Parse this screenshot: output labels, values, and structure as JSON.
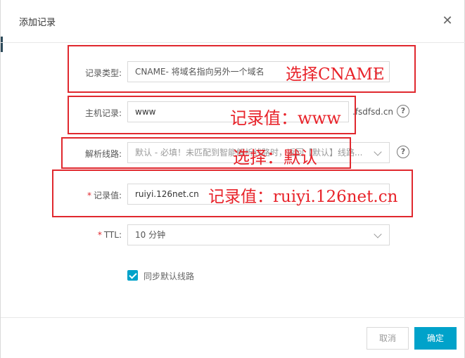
{
  "dialog": {
    "title": "添加记录",
    "close_icon": "close-icon"
  },
  "form": {
    "record_type": {
      "label": "记录类型:",
      "value": "CNAME- 将域名指向另外一个域名"
    },
    "host": {
      "label": "主机记录:",
      "value": "www",
      "suffix": ".fsdfsd.cn"
    },
    "line": {
      "label": "解析线路:",
      "value": "默认 - 必填！未匹配到智能解析线路时，返回【默认】线路..."
    },
    "record_value": {
      "required_mark": "*",
      "label": "记录值:",
      "value": "ruiyi.126net.cn"
    },
    "ttl": {
      "required_mark": "*",
      "label": "TTL:",
      "value": "10 分钟"
    },
    "sync_default": {
      "label": "同步默认线路",
      "checked": true
    },
    "help_icon": "?"
  },
  "annotations": {
    "choose_cname": "选择CNAME",
    "value_www": "记录值：www",
    "choose_default": "选择：默认",
    "value_ruiyi": "记录值：ruiyi.126net.cn"
  },
  "footer": {
    "cancel_label": "取消",
    "ok_label": "确定"
  },
  "colors": {
    "accent": "#00a2ca",
    "annotation_red": "#e0282e"
  }
}
